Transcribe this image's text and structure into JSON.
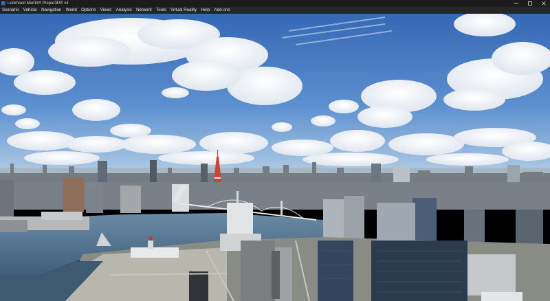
{
  "window": {
    "title": "Lockheed Martin® Prepar3D® v4",
    "app_icon": "prepar3d-logo-icon",
    "controls": [
      "minimize-icon",
      "maximize-icon",
      "close-icon"
    ]
  },
  "menubar": {
    "items": [
      {
        "label": "Scenario"
      },
      {
        "label": "Vehicle"
      },
      {
        "label": "Navigation"
      },
      {
        "label": "World"
      },
      {
        "label": "Options"
      },
      {
        "label": "Views"
      },
      {
        "label": "Analysis"
      },
      {
        "label": "Network"
      },
      {
        "label": "Tools"
      },
      {
        "label": "Virtual Reality"
      },
      {
        "label": "Help"
      },
      {
        "label": "Add-ons"
      }
    ]
  },
  "viewport": {
    "colors": {
      "sky_top": "#3a6fb8",
      "sky_bottom": "#a9c8e6",
      "water": "#4a6e8c",
      "tower": "#d8402a",
      "city_gray": "#7c8288"
    }
  }
}
